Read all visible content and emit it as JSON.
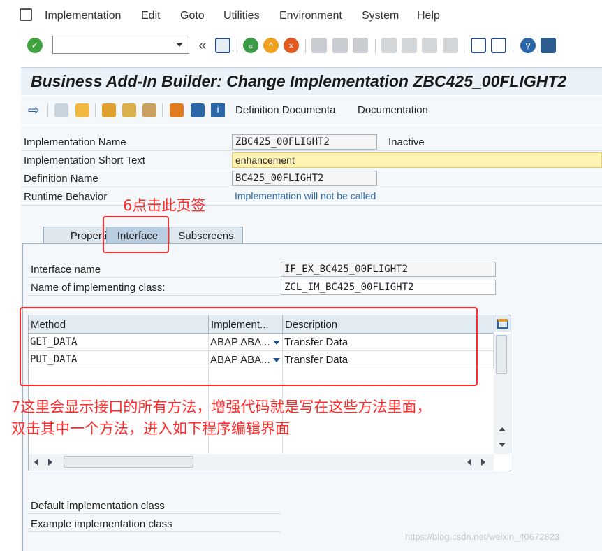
{
  "menubar": {
    "items": [
      "Implementation",
      "Edit",
      "Goto",
      "Utilities",
      "Environment",
      "System",
      "Help"
    ]
  },
  "toolbar": {
    "command_value": "",
    "icons": [
      "enter-icon",
      "command-field-dropdown-icon",
      "back-double-icon",
      "save-icon",
      "back-icon",
      "exit-icon",
      "cancel-icon",
      "print-icon",
      "find-icon",
      "find-next-icon",
      "first-page-icon",
      "previous-page-icon",
      "next-page-icon",
      "last-page-icon",
      "create-session-icon",
      "shortcut-icon",
      "help-icon",
      "customize-layout-icon"
    ]
  },
  "title": "Business Add-In Builder: Change Implementation ZBC425_00FLIGHT2",
  "app_toolbar": {
    "definition_doc": "Definition Documenta",
    "documentation": "Documentation"
  },
  "header_fields": {
    "impl_name_label": "Implementation Name",
    "impl_name_value": "ZBC425_00FLIGHT2",
    "impl_status": "Inactive",
    "short_text_label": "Implementation Short Text",
    "short_text_value": "enhancement",
    "def_name_label": "Definition Name",
    "def_name_value": "BC425_00FLIGHT2",
    "runtime_label": "Runtime Behavior",
    "runtime_value": "Implementation will not be called"
  },
  "tabs": {
    "properties": "Properties",
    "interface": "Interface",
    "subscreens": "Subscreens"
  },
  "interface": {
    "name_label": "Interface name",
    "name_value": "IF_EX_BC425_00FLIGHT2",
    "class_label": "Name of implementing class:",
    "class_value": "ZCL_IM_BC425_00FLIGHT2"
  },
  "grid": {
    "columns": [
      "Method",
      "Implement...",
      "Description"
    ],
    "rows": [
      {
        "method": "GET_DATA",
        "impl": "ABAP ABA...",
        "desc": "Transfer Data"
      },
      {
        "method": "PUT_DATA",
        "impl": "ABAP ABA...",
        "desc": "Transfer Data"
      }
    ]
  },
  "footer": {
    "default_class": "Default implementation class",
    "example_class": "Example implementation class"
  },
  "annotations": {
    "step6": "6点击此页签",
    "step7_line1": "7这里会显示接口的所有方法，增强代码就是写在这些方法里面，",
    "step7_line2": "双击其中一个方法，进入如下程序编辑界面"
  },
  "watermark": "https://blog.csdn.net/weixin_40672823",
  "colors": {
    "annotation_red": "#ff2a2a",
    "title_bg": "#eaf2f8",
    "short_text_yellow": "#fff4b3",
    "runtime_blue": "#2e6aa8"
  }
}
